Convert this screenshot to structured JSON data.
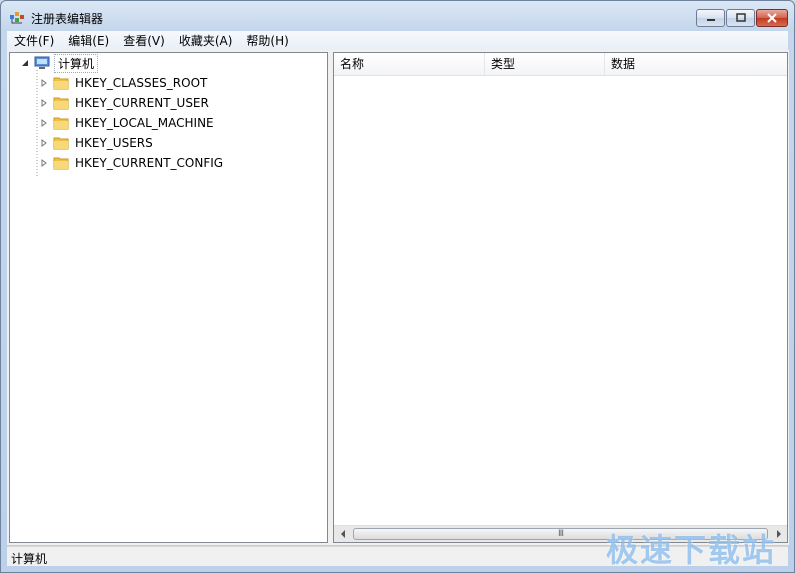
{
  "window": {
    "title": "注册表编辑器"
  },
  "menu": {
    "items": [
      "文件(F)",
      "编辑(E)",
      "查看(V)",
      "收藏夹(A)",
      "帮助(H)"
    ]
  },
  "tree": {
    "root": "计算机",
    "keys": [
      "HKEY_CLASSES_ROOT",
      "HKEY_CURRENT_USER",
      "HKEY_LOCAL_MACHINE",
      "HKEY_USERS",
      "HKEY_CURRENT_CONFIG"
    ]
  },
  "list": {
    "columns": [
      "名称",
      "类型",
      "数据"
    ]
  },
  "scrollbar": {
    "thumb_grip": "III"
  },
  "status": {
    "path": "计算机"
  },
  "watermark": "极速下载站",
  "colors": {
    "accent": "#3f7fcf",
    "close_button": "#c33a22",
    "folder": "#f0c24b"
  }
}
